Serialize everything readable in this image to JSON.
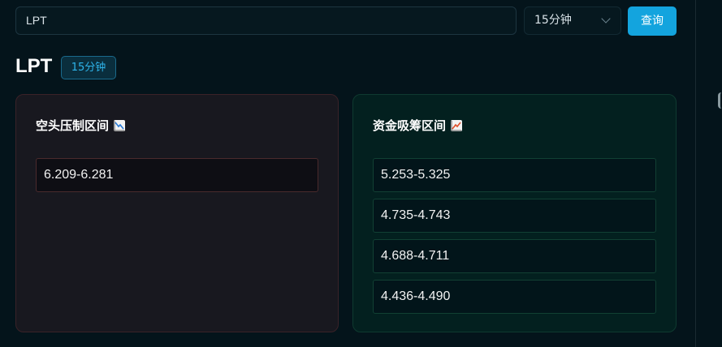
{
  "search": {
    "value": "LPT"
  },
  "interval_select": {
    "selected": "15分钟"
  },
  "query_button": {
    "label": "查询"
  },
  "header": {
    "symbol": "LPT",
    "interval_badge": "15分钟"
  },
  "short_panel": {
    "title": "空头压制区间",
    "icon": "chart-decreasing-icon",
    "zones": [
      "6.209-6.281"
    ]
  },
  "long_panel": {
    "title": "资金吸筹区间",
    "icon": "chart-increasing-icon",
    "zones": [
      "5.253-5.325",
      "4.735-4.743",
      "4.688-4.711",
      "4.436-4.490"
    ]
  },
  "colors": {
    "background": "#04141b",
    "accent": "#13a4de",
    "short_panel_bg": "#18181f",
    "long_panel_bg": "#03201f"
  }
}
